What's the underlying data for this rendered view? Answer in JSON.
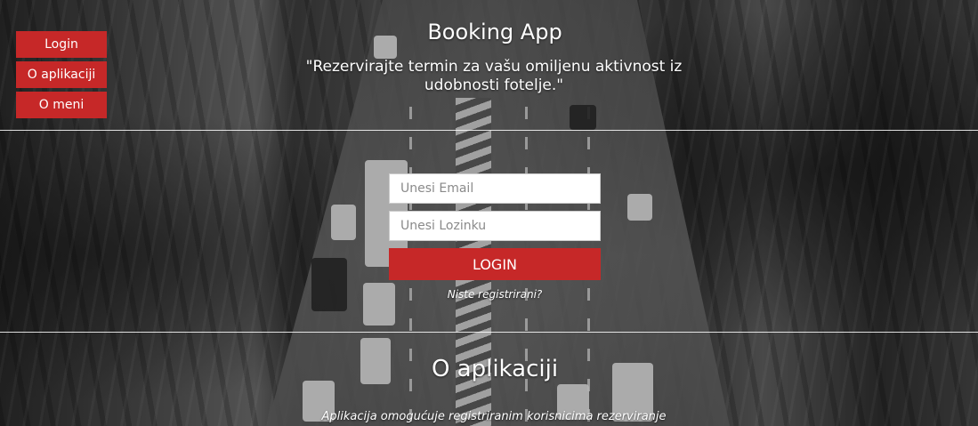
{
  "nav": {
    "login_label": "Login",
    "about_app_label": "O aplikaciji",
    "about_me_label": "O meni"
  },
  "header": {
    "title": "Booking App",
    "subtitle": "\"Rezervirajte termin za vašu omiljenu aktivnost iz udobnosti fotelje.\""
  },
  "login_form": {
    "email_placeholder": "Unesi Email",
    "password_placeholder": "Unesi Lozinku",
    "submit_label": "LOGIN",
    "register_link": "Niste registrirani?"
  },
  "about": {
    "title": "O aplikaciji",
    "text": "Aplikacija omogućuje registriranim korisnicima rezerviranje"
  },
  "colors": {
    "accent": "#c62828",
    "text": "#ffffff"
  }
}
